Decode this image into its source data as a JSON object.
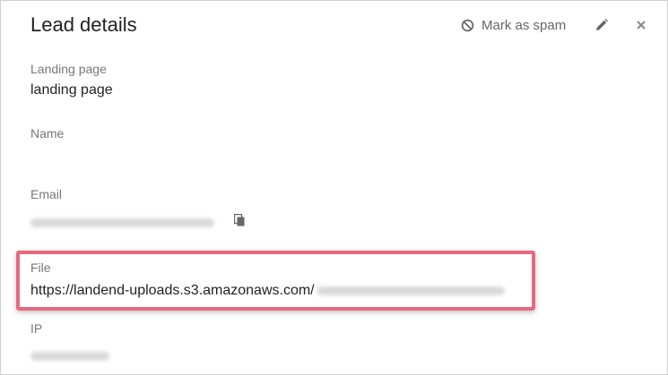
{
  "header": {
    "title": "Lead details",
    "spam_label": "Mark as spam",
    "icons": {
      "spam": "block-icon",
      "edit": "pencil-icon",
      "close": "close-icon",
      "copy": "copy-icon"
    }
  },
  "fields": {
    "landing_page": {
      "label": "Landing page",
      "value": "landing page"
    },
    "name": {
      "label": "Name",
      "value": ""
    },
    "email": {
      "label": "Email",
      "value": "[redacted]"
    },
    "file": {
      "label": "File",
      "value": "https://landend-uploads.s3.amazonaws.com/",
      "suffix": "[redacted]"
    },
    "ip": {
      "label": "IP",
      "value": "[redacted]"
    }
  },
  "colors": {
    "highlight": "#e8697f",
    "muted": "#777777",
    "text": "#222222"
  }
}
